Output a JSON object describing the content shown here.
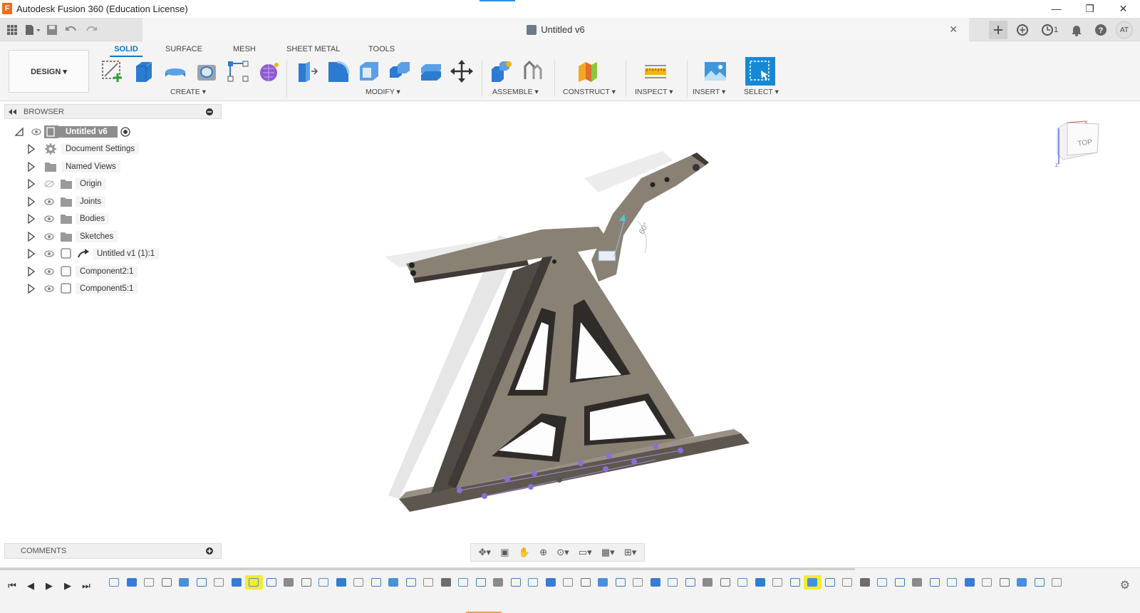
{
  "window": {
    "app_logo": "F",
    "title": "Autodesk Fusion 360 (Education License)",
    "minimize": "—",
    "restore": "❐",
    "close": "✕"
  },
  "toolbar": {
    "doc_title": "Untitled v6",
    "close": "✕",
    "jobs_count": "1",
    "avatar": "AT"
  },
  "ribbon": {
    "workspace": "DESIGN ▾",
    "tabs": [
      "SOLID",
      "SURFACE",
      "MESH",
      "SHEET METAL",
      "TOOLS"
    ],
    "active_tab": "SOLID",
    "groups": [
      "CREATE ▾",
      "MODIFY ▾",
      "ASSEMBLE ▾",
      "CONSTRUCT ▾",
      "INSPECT ▾",
      "INSERT ▾",
      "SELECT ▾"
    ]
  },
  "browser": {
    "header": "BROWSER",
    "items": [
      {
        "label": "Untitled v6"
      },
      {
        "label": "Document Settings"
      },
      {
        "label": "Named Views"
      },
      {
        "label": "Origin"
      },
      {
        "label": "Joints"
      },
      {
        "label": "Bodies"
      },
      {
        "label": "Sketches"
      },
      {
        "label": "Untitled v1 (1):1"
      },
      {
        "label": "Component2:1"
      },
      {
        "label": "Component5:1"
      }
    ]
  },
  "comments": {
    "header": "COMMENTS"
  },
  "viewport": {
    "angle_label": "60°",
    "viewcube_face": "TOP",
    "model_color": "#8a8175",
    "accent": "#0a77d0"
  }
}
